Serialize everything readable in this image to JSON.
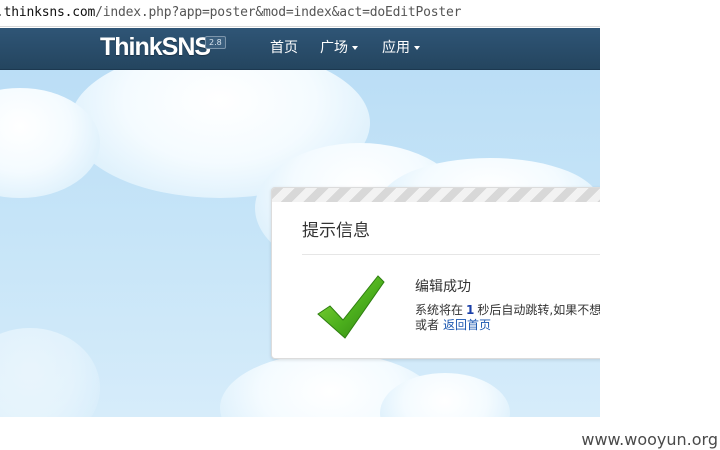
{
  "browser": {
    "url_prefix": ".",
    "url_host": "thinksns.com",
    "url_path": "/index.php?app=poster&mod=index&act=doEditPoster"
  },
  "nav": {
    "logo_text": "ThinkSNS",
    "logo_version": "2.8",
    "items": [
      {
        "label": "首页",
        "has_dropdown": false
      },
      {
        "label": "广场",
        "has_dropdown": true
      },
      {
        "label": "应用",
        "has_dropdown": true
      }
    ],
    "bar_color": "#24455f"
  },
  "notice": {
    "title": "提示信息",
    "success_message": "编辑成功",
    "redirect_before": "系统将在",
    "countdown_seconds": "1",
    "redirect_after": "秒后自动跳转,如果不想等",
    "fallback_prefix": "或者",
    "home_link": "返回首页",
    "icon": "checkmark-icon",
    "accent_color": "#4caf1d",
    "link_color": "#1a56b0"
  },
  "watermark": "www.wooyun.org"
}
